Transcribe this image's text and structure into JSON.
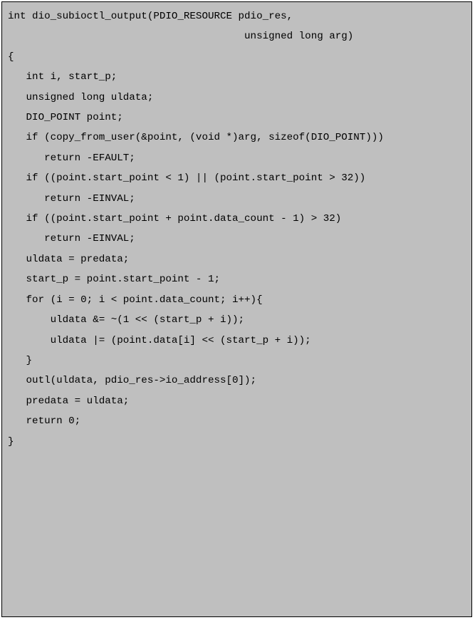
{
  "code": {
    "lines": [
      "int dio_subioctl_output(PDIO_RESOURCE pdio_res,",
      "                                       unsigned long arg)",
      "{",
      "   int i, start_p;",
      "   unsigned long uldata;",
      "   DIO_POINT point;",
      "",
      "   if (copy_from_user(&point, (void *)arg, sizeof(DIO_POINT)))",
      "      return -EFAULT;",
      "",
      "   if ((point.start_point < 1) || (point.start_point > 32))",
      "      return -EINVAL;",
      "   if ((point.start_point + point.data_count - 1) > 32)",
      "      return -EINVAL;",
      "",
      "   uldata = predata;",
      "   start_p = point.start_point - 1;",
      "",
      "   for (i = 0; i < point.data_count; i++){",
      "       uldata &= ~(1 << (start_p + i));",
      "       uldata |= (point.data[i] << (start_p + i));",
      "   }",
      "",
      "   outl(uldata, pdio_res->io_address[0]);",
      "   predata = uldata;",
      "",
      "   return 0;",
      "}"
    ]
  }
}
